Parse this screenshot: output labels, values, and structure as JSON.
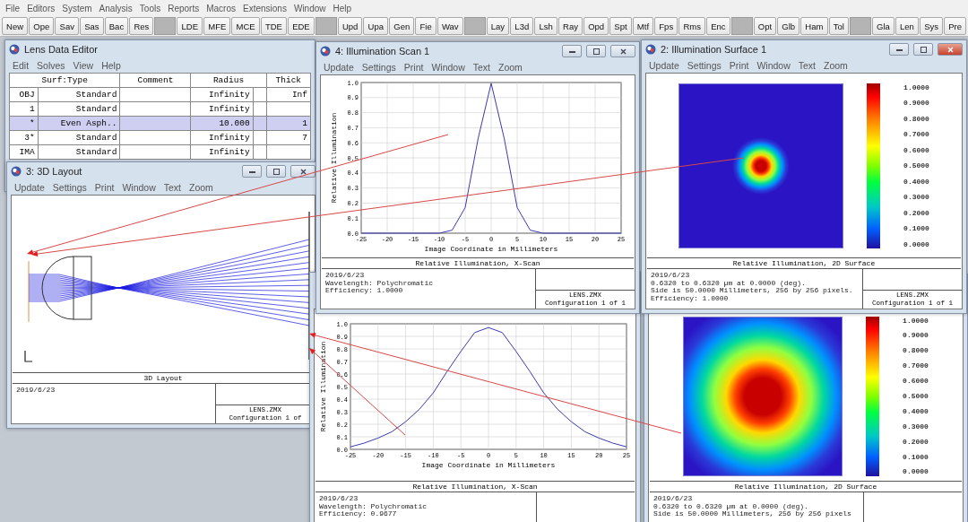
{
  "menubar": [
    "File",
    "Editors",
    "System",
    "Analysis",
    "Tools",
    "Reports",
    "Macros",
    "Extensions",
    "Window",
    "Help"
  ],
  "toolbar": [
    {
      "kind": "button",
      "label": "New"
    },
    {
      "kind": "button",
      "label": "Ope"
    },
    {
      "kind": "button",
      "label": "Sav"
    },
    {
      "kind": "button",
      "label": "Sas"
    },
    {
      "kind": "button",
      "label": "Bac"
    },
    {
      "kind": "button",
      "label": "Res"
    },
    {
      "kind": "separator"
    },
    {
      "kind": "button",
      "label": "LDE"
    },
    {
      "kind": "button",
      "label": "MFE"
    },
    {
      "kind": "button",
      "label": "MCE"
    },
    {
      "kind": "button",
      "label": "TDE"
    },
    {
      "kind": "button",
      "label": "EDE"
    },
    {
      "kind": "separator"
    },
    {
      "kind": "button",
      "label": "Upd"
    },
    {
      "kind": "button",
      "label": "Upa"
    },
    {
      "kind": "button",
      "label": "Gen"
    },
    {
      "kind": "button",
      "label": "Fie"
    },
    {
      "kind": "button",
      "label": "Wav"
    },
    {
      "kind": "separator"
    },
    {
      "kind": "button",
      "label": "Lay"
    },
    {
      "kind": "button",
      "label": "L3d"
    },
    {
      "kind": "button",
      "label": "Lsh"
    },
    {
      "kind": "button",
      "label": "Ray"
    },
    {
      "kind": "button",
      "label": "Opd"
    },
    {
      "kind": "button",
      "label": "Spt"
    },
    {
      "kind": "button",
      "label": "Mtf"
    },
    {
      "kind": "button",
      "label": "Fps"
    },
    {
      "kind": "button",
      "label": "Rms"
    },
    {
      "kind": "button",
      "label": "Enc"
    },
    {
      "kind": "separator"
    },
    {
      "kind": "button",
      "label": "Opt"
    },
    {
      "kind": "button",
      "label": "Glb"
    },
    {
      "kind": "button",
      "label": "Ham"
    },
    {
      "kind": "button",
      "label": "Tol"
    },
    {
      "kind": "separator"
    },
    {
      "kind": "button",
      "label": "Gla"
    },
    {
      "kind": "button",
      "label": "Len"
    },
    {
      "kind": "button",
      "label": "Sys"
    },
    {
      "kind": "button",
      "label": "Pre"
    }
  ],
  "lens_data_editor": {
    "title": "Lens Data Editor",
    "menu": [
      "Edit",
      "Solves",
      "View",
      "Help"
    ],
    "columns": [
      "Surf:Type",
      "Comment",
      "Radius",
      "Thick"
    ],
    "rows": [
      {
        "surface": "OBJ",
        "type": "Standard",
        "radius": "Infinity",
        "thickness": "Inf",
        "selected": false
      },
      {
        "surface": "1",
        "type": "Standard",
        "radius": "Infinity",
        "selected": false
      },
      {
        "surface": "*",
        "type": "Even Asph..",
        "radius": "10.000",
        "thickness": "1",
        "selected": true
      },
      {
        "surface": "3*",
        "type": "Standard",
        "radius": "Infinity",
        "thickness": "7",
        "selected": false
      },
      {
        "surface": "IMA",
        "type": "Standard",
        "radius": "Infinity",
        "selected": false
      }
    ]
  },
  "layout_3d": {
    "title": "3: 3D Layout",
    "active": false,
    "menu": [
      "Update",
      "Settings",
      "Print",
      "Window",
      "Text",
      "Zoom"
    ],
    "plot_title": "3D Layout",
    "info": [
      "2019/6/23"
    ],
    "file": "LENS.ZMX",
    "configuration": "Configuration 1 of"
  },
  "illumination_scan": {
    "title": "4: Illumination Scan 1",
    "active": false,
    "menu": [
      "Update",
      "Settings",
      "Print",
      "Window",
      "Text",
      "Zoom"
    ],
    "chart_data": {
      "type": "line",
      "xlabel": "Image Coordinate in Millimeters",
      "ylabel": "Relative Illumination",
      "x": [
        -25,
        -22.5,
        -20,
        -17.5,
        -15,
        -12.5,
        -10,
        -7.5,
        -5,
        -2.5,
        0,
        2.5,
        5,
        7.5,
        10,
        12.5,
        15,
        17.5,
        20,
        22.5,
        25
      ],
      "series": [
        {
          "color": "#3a3ab0",
          "values": [
            0,
            0,
            0,
            0,
            0,
            0,
            0,
            0.02,
            0.17,
            0.63,
            0.995,
            0.63,
            0.17,
            0.02,
            0,
            0,
            0,
            0,
            0,
            0,
            0
          ]
        }
      ],
      "xlim": [
        -25,
        25
      ],
      "ylim": [
        0,
        1
      ],
      "xticks": [
        -25,
        -20,
        -15,
        -10,
        -5,
        0,
        5,
        10,
        15,
        20,
        25
      ],
      "yticks": [
        {
          "value": 0,
          "label": "0.0"
        },
        0.1,
        0.2,
        0.3,
        0.4,
        0.5,
        0.6,
        0.7,
        0.8,
        0.9,
        {
          "value": 1,
          "label": "1.0"
        }
      ],
      "grid": true
    },
    "plot_title": "Relative Illumination, X-Scan",
    "info": [
      "2019/6/23",
      "Wavelength: Polychromatic",
      "Efficiency: 1.0000"
    ],
    "file": "LENS.ZMX",
    "configuration": "Configuration 1 of 1"
  },
  "illumination_surface": {
    "title": "2: Illumination Surface 1",
    "active": true,
    "menu": [
      "Update",
      "Settings",
      "Print",
      "Window",
      "Text",
      "Zoom"
    ],
    "legend": [
      "1.0000",
      "0.9000",
      "0.8000",
      "0.7000",
      "0.6000",
      "0.5000",
      "0.4000",
      "0.3000",
      "0.2000",
      "0.1000",
      "0.0000"
    ],
    "plot_title": "Relative Illumination, 2D Surface",
    "info": [
      "2019/6/23",
      "0.6320 to 0.6320 µm at 0.0000 (deg).",
      "Side is 50.0000 Millimeters, 256 by 256 pixels.",
      "Efficiency: 1.0000"
    ],
    "file": "LENS.ZMX",
    "configuration": "Configuration 1 of 1"
  },
  "illumination_scan_lower": {
    "chart_data": {
      "type": "line",
      "xlabel": "Image Coordinate in Millimeters",
      "ylabel": "Relative Illumination",
      "x": [
        -25,
        -22.5,
        -20,
        -17.5,
        -15,
        -12.5,
        -10,
        -7.5,
        -5,
        -2.5,
        0,
        2.5,
        5,
        7.5,
        10,
        12.5,
        15,
        17.5,
        20,
        22.5,
        25
      ],
      "series": [
        {
          "color": "#3a3ab0",
          "values": [
            0.02,
            0.05,
            0.09,
            0.14,
            0.22,
            0.32,
            0.45,
            0.62,
            0.78,
            0.93,
            0.97,
            0.93,
            0.78,
            0.62,
            0.45,
            0.32,
            0.22,
            0.14,
            0.09,
            0.05,
            0.02
          ]
        }
      ],
      "xlim": [
        -25,
        25
      ],
      "ylim": [
        0,
        1
      ],
      "xticks": [
        -25,
        -20,
        -15,
        -10,
        -5,
        0,
        5,
        10,
        15,
        20,
        25
      ],
      "yticks": [
        {
          "value": 0,
          "label": "0.0"
        },
        0.1,
        0.2,
        0.3,
        0.4,
        0.5,
        0.6,
        0.7,
        0.8,
        0.9,
        {
          "value": 1,
          "label": "1.0"
        }
      ],
      "grid": true
    },
    "plot_title": "Relative Illumination, X-Scan",
    "info": [
      "2019/6/23",
      "Wavelength: Polychromatic",
      "Efficiency: 0.9677"
    ]
  },
  "illumination_surface_lower": {
    "legend": [
      "1.0000",
      "0.9000",
      "0.8000",
      "0.7000",
      "0.6000",
      "0.5000",
      "0.4000",
      "0.3000",
      "0.2000",
      "0.1000",
      "0.0000"
    ],
    "plot_title": "Relative Illumination, 2D Surface",
    "info": [
      "2019/6/23",
      "0.6320 to 0.6320 µm at 0.0000 (deg).",
      "Side is 50.0000 Millimeters, 256 by 256 pixels"
    ]
  }
}
